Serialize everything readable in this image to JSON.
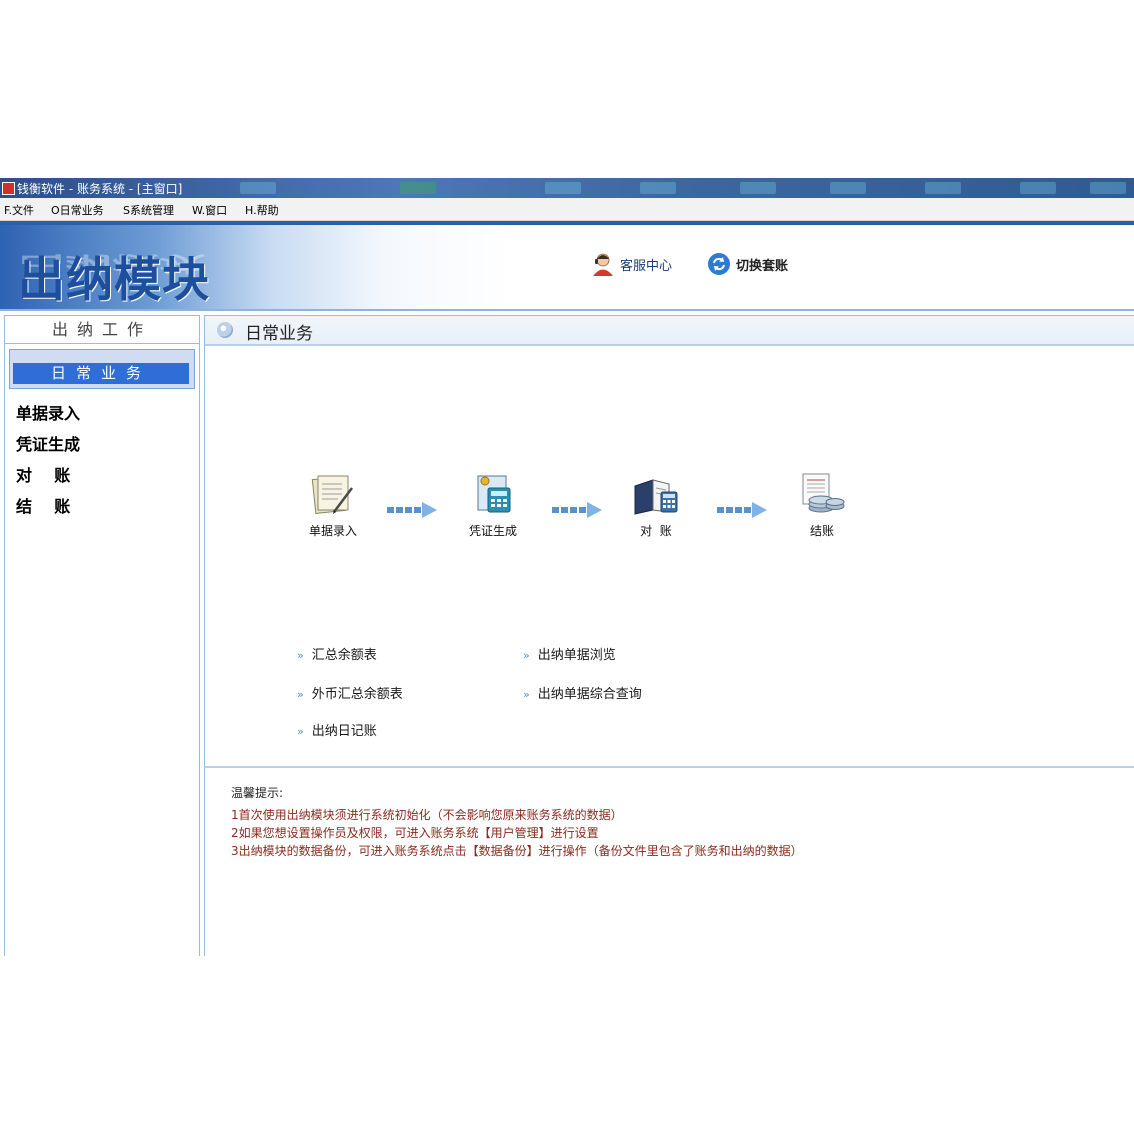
{
  "window": {
    "title": "钱衡软件 - 账务系统 - [主窗口]"
  },
  "menu": {
    "items": [
      "F.文件",
      "O日常业务",
      "S系统管理",
      "W.窗口",
      "H.帮助"
    ]
  },
  "banner": {
    "title": "出纳模块",
    "service_label": "客服中心",
    "switch_label": "切换套账"
  },
  "sidebar": {
    "header": "出纳工作",
    "active_tab": "日常业务",
    "items": [
      "单据录入",
      "凭证生成",
      "对    账",
      "结    账"
    ]
  },
  "main": {
    "title": "日常业务",
    "flow": [
      {
        "label": "单据录入",
        "icon": "documents-icon"
      },
      {
        "label": "凭证生成",
        "icon": "voucher-icon"
      },
      {
        "label": "对  账",
        "icon": "ledger-icon"
      },
      {
        "label": "结账",
        "icon": "coins-icon"
      }
    ],
    "reports_left": [
      "汇总余额表",
      "外币汇总余额表",
      "出纳日记账"
    ],
    "reports_right": [
      "出纳单据浏览",
      "出纳单据综合查询"
    ]
  },
  "tips": {
    "title": "温馨提示:",
    "lines": [
      "1首次使用出纳模块须进行系统初始化（不会影响您原来账务系统的数据）",
      "2如果您想设置操作员及权限，可进入账务系统【用户管理】进行设置",
      "3出纳模块的数据备份，可进入账务系统点击【数据备份】进行操作（备份文件里包含了账务和出纳的数据）"
    ]
  },
  "colors": {
    "title_bar": "#3c679f",
    "banner_blue": "#1e4f9c",
    "sidebar_tab": "#2f6ed6",
    "border": "#9bbbe0",
    "tip_text": "#8a2a1e"
  }
}
